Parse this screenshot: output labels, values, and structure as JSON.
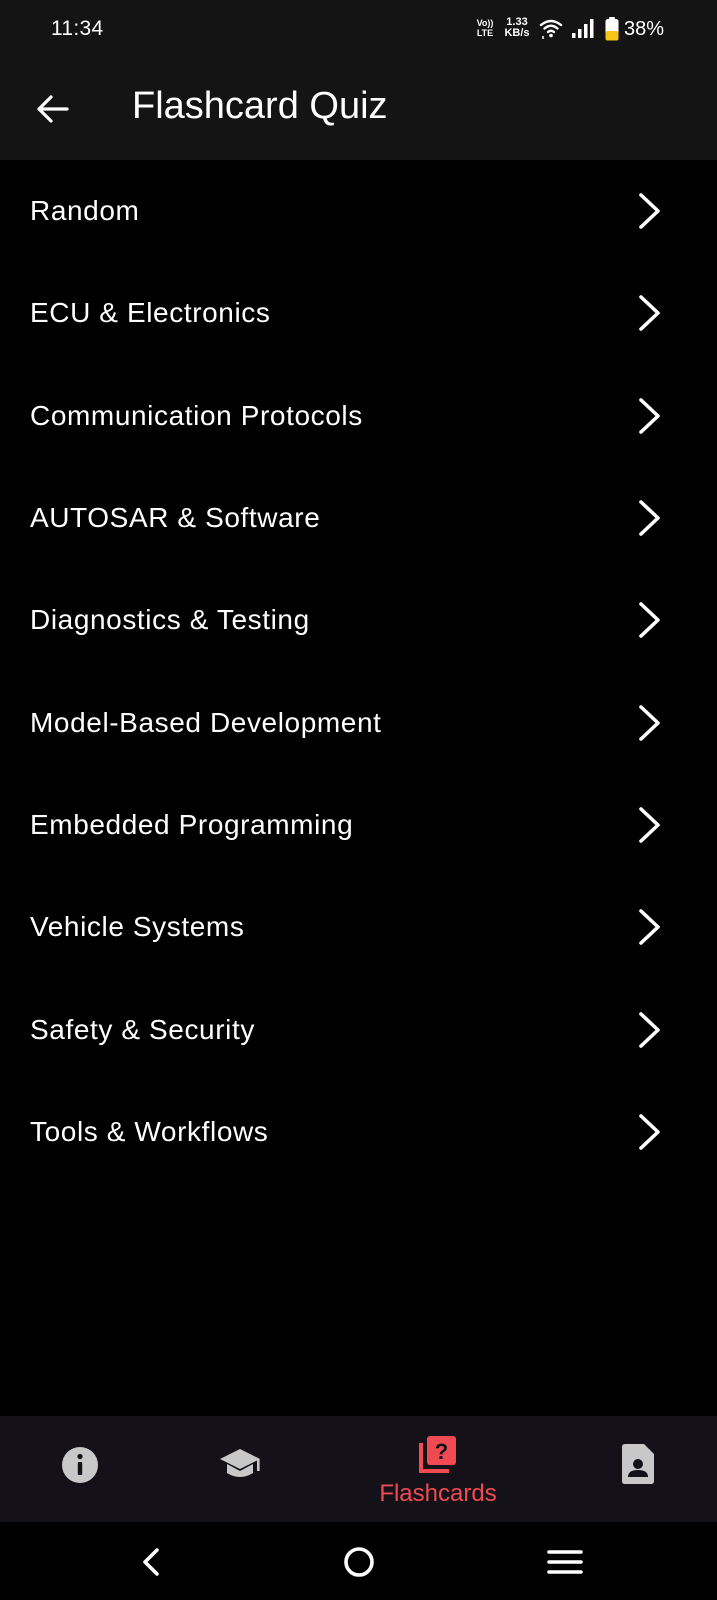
{
  "status_bar": {
    "time": "11:34",
    "volte_line1": "Vo))",
    "volte_line2": "LTE",
    "net_speed_value": "1.33",
    "net_speed_unit": "KB/s",
    "battery_percent": "38%",
    "battery_level": 0.38,
    "icons": [
      "wifi-icon",
      "signal-icon",
      "battery-icon"
    ]
  },
  "app_bar": {
    "title": "Flashcard Quiz",
    "back_icon": "arrow-back-icon"
  },
  "categories": [
    {
      "label": "Random"
    },
    {
      "label": "ECU & Electronics"
    },
    {
      "label": "Communication Protocols"
    },
    {
      "label": "AUTOSAR & Software"
    },
    {
      "label": "Diagnostics & Testing"
    },
    {
      "label": "Model-Based Development"
    },
    {
      "label": "Embedded Programming"
    },
    {
      "label": "Vehicle Systems"
    },
    {
      "label": "Safety & Security"
    },
    {
      "label": "Tools & Workflows"
    }
  ],
  "bottom_nav": {
    "items": [
      {
        "icon": "info-icon",
        "label": ""
      },
      {
        "icon": "graduation-cap-icon",
        "label": ""
      },
      {
        "icon": "flashcards-icon",
        "label": "Flashcards",
        "active": true
      },
      {
        "icon": "contact-card-icon",
        "label": ""
      }
    ],
    "active_color": "#f04a53",
    "inactive_color": "#c8c8c8"
  },
  "system_nav": {
    "buttons": [
      "back-icon",
      "home-icon",
      "recents-menu-icon"
    ]
  }
}
